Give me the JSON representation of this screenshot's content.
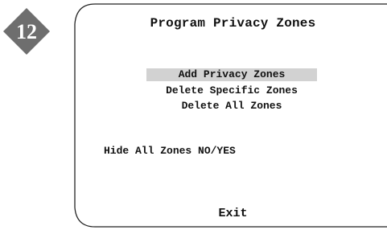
{
  "step_badge": {
    "number": "12",
    "color": "#6e6e6e",
    "text_color": "#ffffff"
  },
  "screen": {
    "title": "Program Privacy Zones",
    "menu_items": [
      {
        "label": "Add Privacy Zones",
        "selected": true
      },
      {
        "label": "Delete Specific Zones",
        "selected": false
      },
      {
        "label": "Delete All Zones",
        "selected": false
      }
    ],
    "hide_all_zones": "Hide All Zones NO/YES",
    "exit": "Exit",
    "highlight_color": "#d2d2d2"
  }
}
